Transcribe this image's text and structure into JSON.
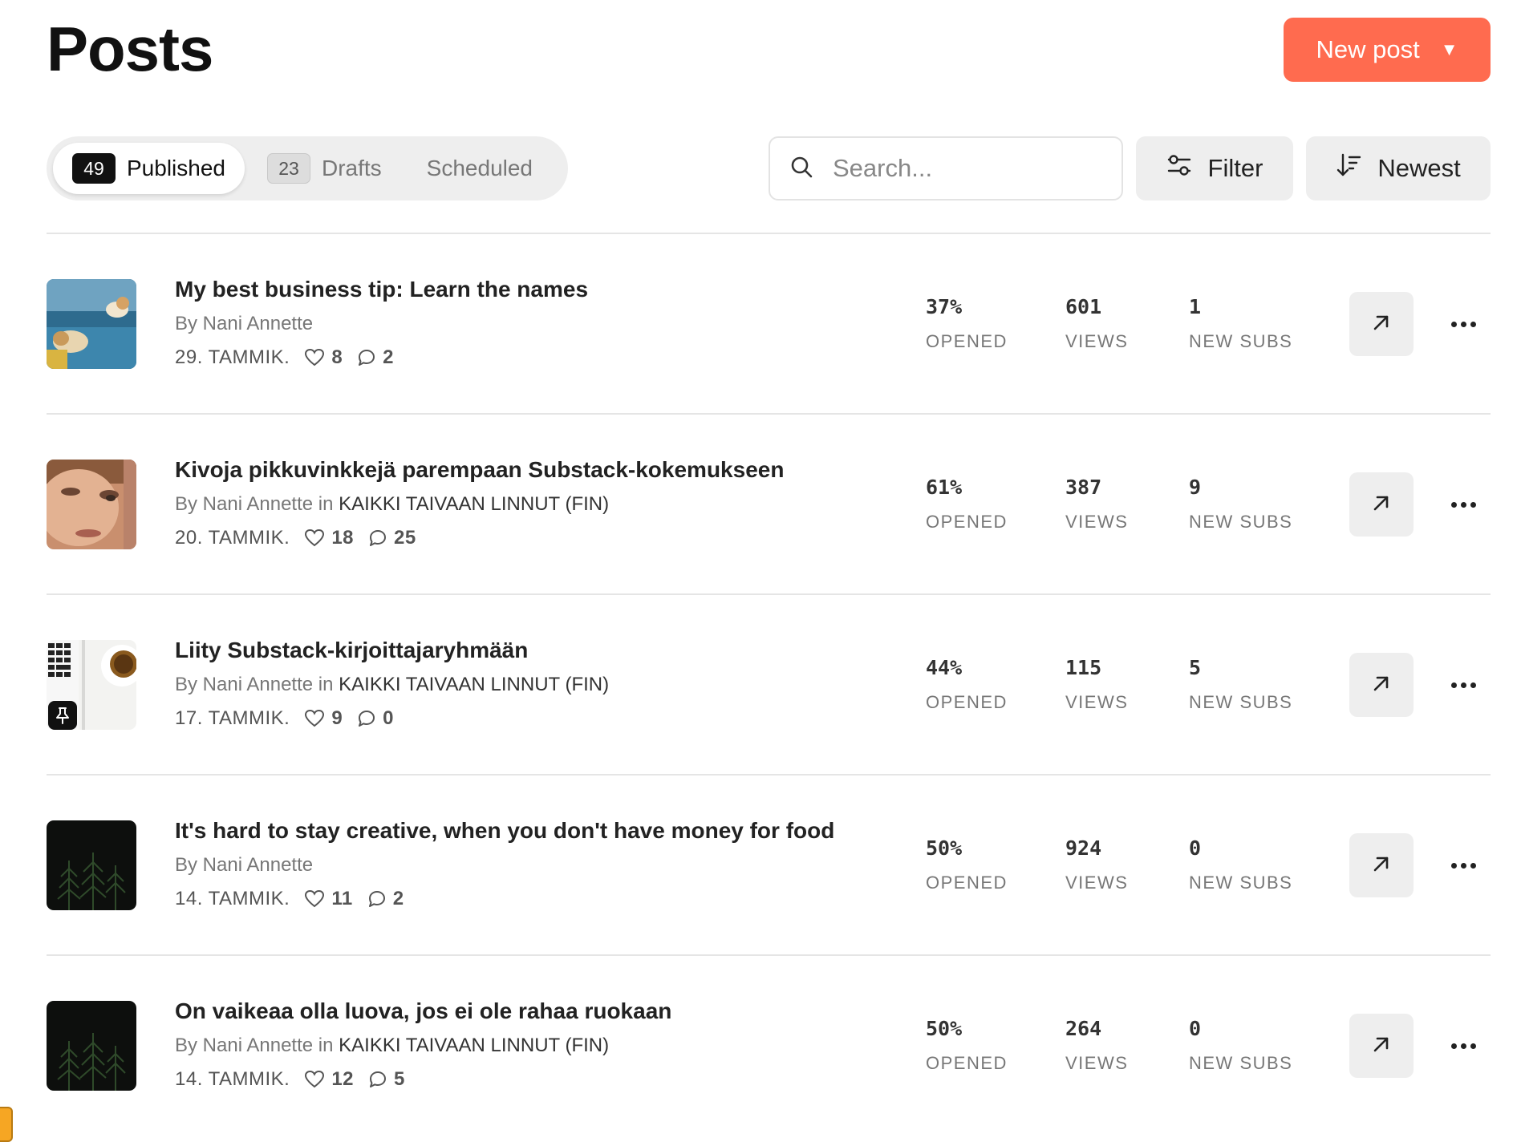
{
  "header": {
    "title": "Posts",
    "new_post_label": "New post",
    "new_post_color": "#ff6b4f"
  },
  "tabs": [
    {
      "count": "49",
      "label": "Published",
      "active": true
    },
    {
      "count": "23",
      "label": "Drafts",
      "active": false
    },
    {
      "count": "",
      "label": "Scheduled",
      "active": false
    }
  ],
  "search": {
    "placeholder": "Search...",
    "icon": "search-icon"
  },
  "filter": {
    "label": "Filter",
    "icon": "sliders-icon"
  },
  "sort": {
    "label": "Newest",
    "icon": "sort-descending-icon"
  },
  "posts": [
    {
      "title": "My best business tip: Learn the names",
      "byline": "By Nani Annette",
      "publication": "",
      "date": "29. TAMMIK.",
      "likes": "8",
      "comments": "2",
      "opened": "37%",
      "views": "601",
      "new_subs": "1",
      "thumb": "dog-on-couch",
      "pinned": false
    },
    {
      "title": "Kivoja pikkuvinkkejä parempaan Substack-kokemukseen",
      "byline": "By Nani Annette in",
      "publication": "KAIKKI TAIVAAN LINNUT (FIN)",
      "date": "20. TAMMIK.",
      "likes": "18",
      "comments": "25",
      "opened": "61%",
      "views": "387",
      "new_subs": "9",
      "thumb": "face-closeup",
      "pinned": false
    },
    {
      "title": "Liity Substack-kirjoittajaryhmään",
      "byline": "By Nani Annette in",
      "publication": "KAIKKI TAIVAAN LINNUT (FIN)",
      "date": "17. TAMMIK.",
      "likes": "9",
      "comments": "0",
      "opened": "44%",
      "views": "115",
      "new_subs": "5",
      "thumb": "keyboard-and-coffee",
      "pinned": true
    },
    {
      "title": "It's hard to stay creative, when you don't have money for food",
      "byline": "By Nani Annette",
      "publication": "",
      "date": "14. TAMMIK.",
      "likes": "11",
      "comments": "2",
      "opened": "50%",
      "views": "924",
      "new_subs": "0",
      "thumb": "dark-ferns",
      "pinned": false
    },
    {
      "title": "On vaikeaa olla luova, jos ei ole rahaa ruokaan",
      "byline": "By Nani Annette in",
      "publication": "KAIKKI TAIVAAN LINNUT (FIN)",
      "date": "14. TAMMIK.",
      "likes": "12",
      "comments": "5",
      "opened": "50%",
      "views": "264",
      "new_subs": "0",
      "thumb": "dark-ferns",
      "pinned": false
    }
  ],
  "stat_labels": {
    "opened": "OPENED",
    "views": "VIEWS",
    "new_subs": "NEW SUBS"
  }
}
